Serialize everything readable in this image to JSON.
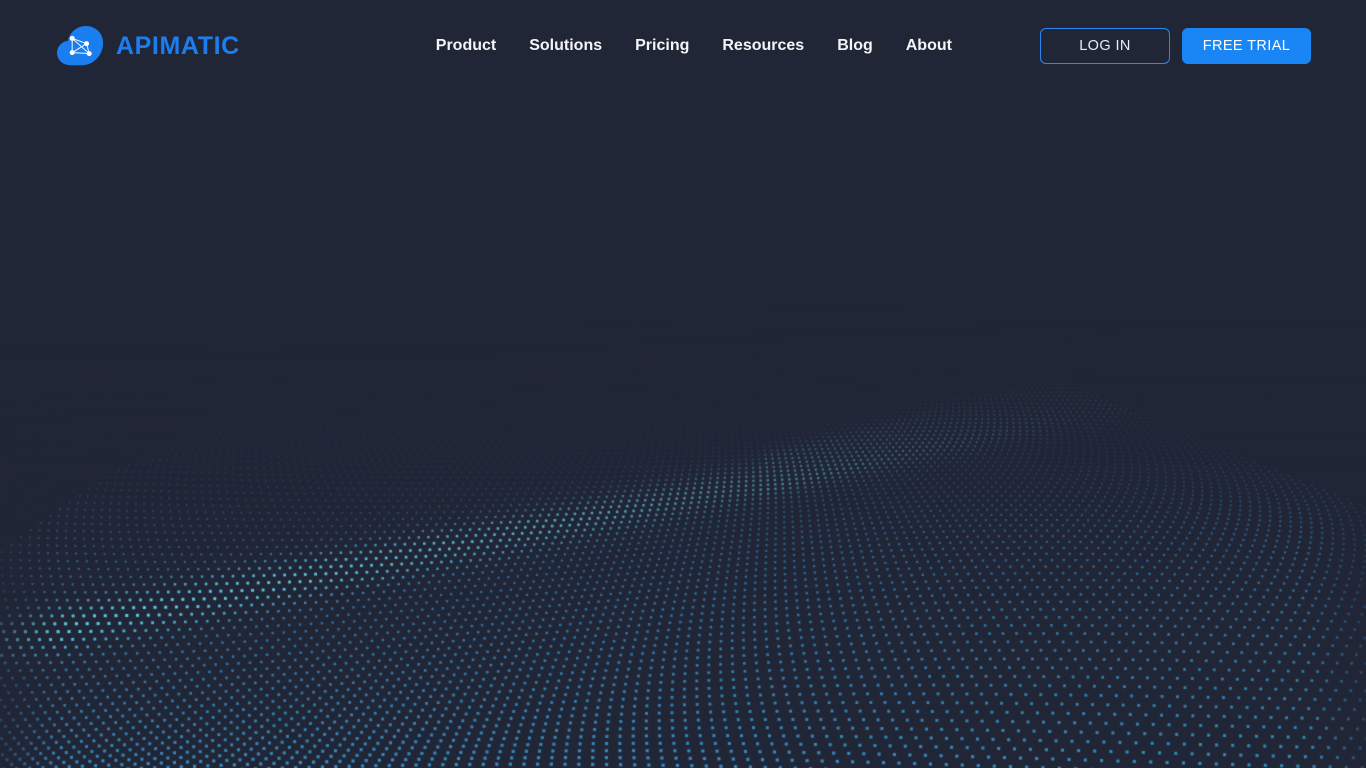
{
  "site": {
    "background_color": "#212637",
    "accent_color": "#1a85f5",
    "logo_text_color": "#1a7ef0",
    "wave_highlight_color": "#3bb4e8"
  },
  "header": {
    "brand": {
      "icon": "apimatic-cloud-network-logo",
      "name": "APIMATIC"
    },
    "nav": [
      {
        "label": "Product"
      },
      {
        "label": "Solutions"
      },
      {
        "label": "Pricing"
      },
      {
        "label": "Resources"
      },
      {
        "label": "Blog"
      },
      {
        "label": "About"
      }
    ],
    "actions": {
      "login_label": "LOG IN",
      "trial_label": "FREE TRIAL"
    }
  },
  "hero": {
    "background": {
      "style": "particle-wave",
      "description": "3D perspective grid of blue dots forming flowing S-curve wave lines across the lower two thirds of the viewport, with a bright diagonal crest running from lower-left to upper-right",
      "base_color": "#212637",
      "dot_color_near": "#4cc6f0",
      "dot_color_far": "#2e5f86",
      "crest_color": "#45bdee"
    }
  }
}
